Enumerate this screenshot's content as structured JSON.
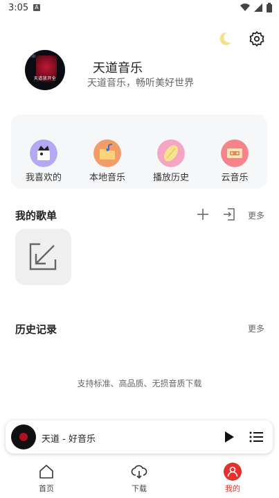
{
  "status_bar": {
    "time": "3:05",
    "notif_letter": "A"
  },
  "profile": {
    "name": "天道音乐",
    "subtitle": "天道音乐，畅听美好世界",
    "avatar_caption": "天道放开全"
  },
  "quick_actions": [
    {
      "label": "我喜欢的",
      "icon": "favorites-icon",
      "color": "#b3a9f3"
    },
    {
      "label": "本地音乐",
      "icon": "folder-music-icon",
      "color": "#f29c68"
    },
    {
      "label": "播放历史",
      "icon": "history-disc-icon",
      "color": "#f4a5c4"
    },
    {
      "label": "云音乐",
      "icon": "cassette-icon",
      "color": "#f5848a"
    }
  ],
  "my_playlists": {
    "title": "我的歌单",
    "more": "更多"
  },
  "history": {
    "title": "历史记录",
    "more": "更多",
    "empty_text": "支持标准、高品质、无损音质下载"
  },
  "player": {
    "title": "天道 - 好音乐"
  },
  "bottom_nav": [
    {
      "label": "首页",
      "icon": "home-icon"
    },
    {
      "label": "下载",
      "icon": "cloud-download-icon"
    },
    {
      "label": "我的",
      "icon": "user-icon"
    }
  ],
  "colors": {
    "accent": "#e3312d",
    "card_bg": "#f6f7f9"
  }
}
